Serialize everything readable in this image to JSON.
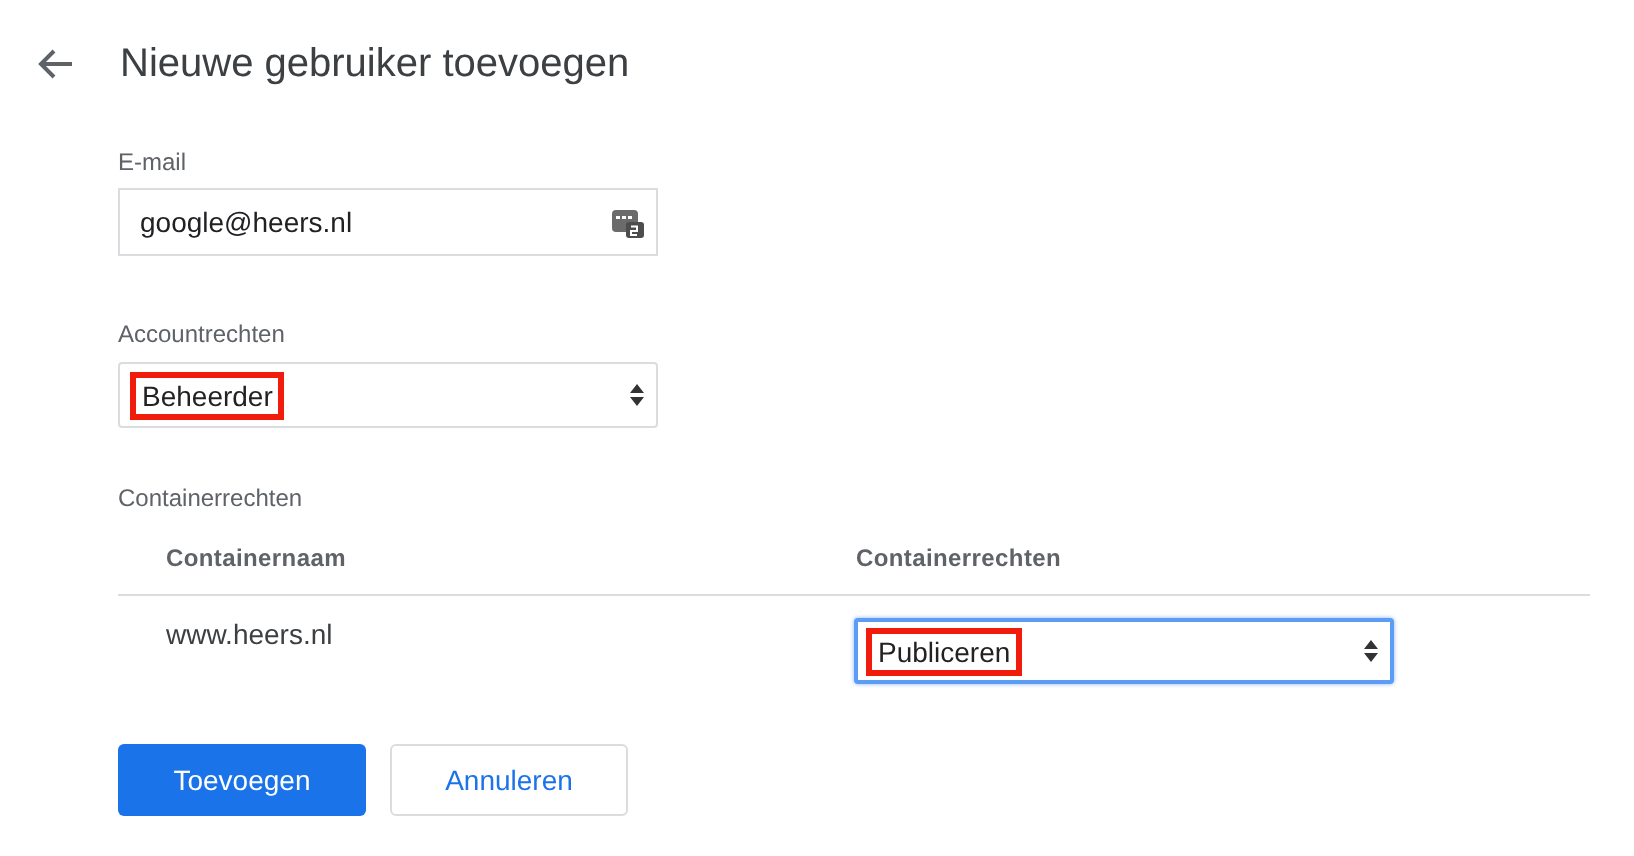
{
  "title": "Nieuwe gebruiker toevoegen",
  "email": {
    "label": "E-mail",
    "value": "google@heers.nl"
  },
  "account_rights": {
    "label": "Accountrechten",
    "value": "Beheerder",
    "highlighted": true,
    "focused": false
  },
  "container_rights": {
    "label": "Containerrechten",
    "columns": [
      "Containernaam",
      "Containerrechten"
    ],
    "rows": [
      {
        "name": "www.heers.nl",
        "permission": {
          "value": "Publiceren",
          "highlighted": true,
          "focused": true
        }
      }
    ]
  },
  "buttons": [
    {
      "label": "Toevoegen",
      "kind": "primary"
    },
    {
      "label": "Annuleren",
      "kind": "secondary"
    }
  ]
}
